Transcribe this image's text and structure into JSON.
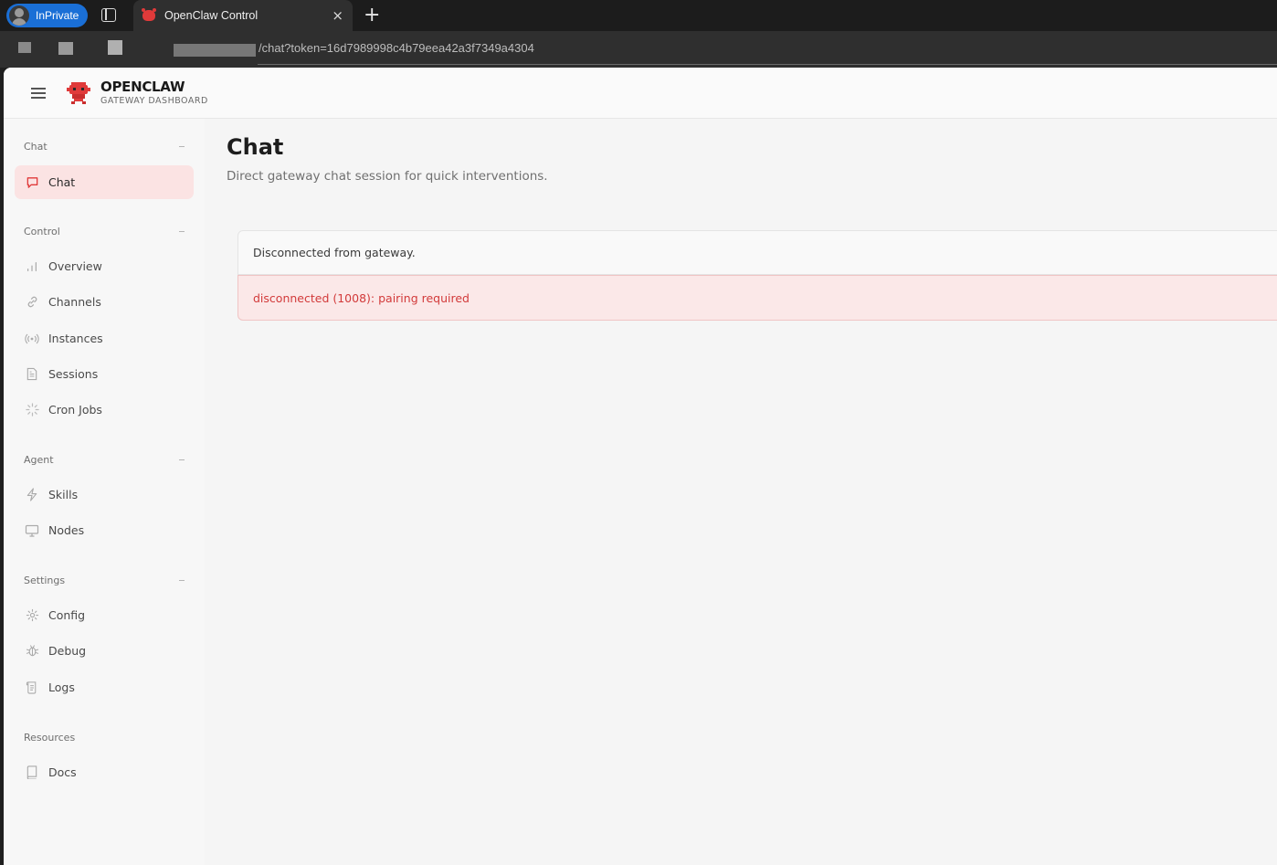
{
  "browser": {
    "profile_label": "InPrivate",
    "tab_title": "OpenClaw Control",
    "tab_close": "×",
    "new_tab": "+",
    "url": "/chat?token=16d7989998c4b79eea42a3f7349a4304"
  },
  "brand": {
    "title": "OPENCLAW",
    "subtitle": "GATEWAY DASHBOARD",
    "accent_color": "#e03a3a"
  },
  "sidebar": {
    "sections": [
      {
        "heading": "Chat",
        "items": [
          {
            "label": "Chat",
            "icon": "chat-bubble-icon",
            "active": true
          }
        ]
      },
      {
        "heading": "Control",
        "items": [
          {
            "label": "Overview",
            "icon": "bar-chart-icon"
          },
          {
            "label": "Channels",
            "icon": "link-icon"
          },
          {
            "label": "Instances",
            "icon": "radio-signal-icon"
          },
          {
            "label": "Sessions",
            "icon": "document-icon"
          },
          {
            "label": "Cron Jobs",
            "icon": "loader-icon"
          }
        ]
      },
      {
        "heading": "Agent",
        "items": [
          {
            "label": "Skills",
            "icon": "lightning-icon"
          },
          {
            "label": "Nodes",
            "icon": "monitor-icon"
          }
        ]
      },
      {
        "heading": "Settings",
        "items": [
          {
            "label": "Config",
            "icon": "gear-icon"
          },
          {
            "label": "Debug",
            "icon": "bug-icon"
          },
          {
            "label": "Logs",
            "icon": "scroll-icon"
          }
        ]
      },
      {
        "heading": "Resources",
        "items": [
          {
            "label": "Docs",
            "icon": "book-icon"
          }
        ]
      }
    ]
  },
  "main": {
    "title": "Chat",
    "subtitle": "Direct gateway chat session for quick interventions.",
    "status_message": "Disconnected from gateway.",
    "error_message": "disconnected (1008): pairing required"
  }
}
